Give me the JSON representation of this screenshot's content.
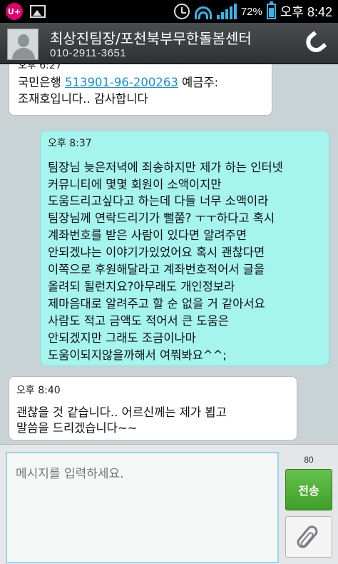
{
  "status_bar": {
    "carrier_logo": "U+",
    "battery_percent": "72%",
    "time": "오후 8:42",
    "icons": [
      "uplus-icon",
      "gallery-icon",
      "alarm-icon",
      "wifi-icon",
      "signal-icon",
      "battery-icon"
    ]
  },
  "header": {
    "contact_name": "최상진팀장/포천북부무한돌봄센터",
    "contact_phone": "010-2911-3651"
  },
  "messages": [
    {
      "direction": "incoming",
      "time": "오후 6:27",
      "text_before": "국민은행 ",
      "account_number": "513901-96-200263",
      "text_after": " 예금주:\n조재호입니다.. 감사합니다"
    },
    {
      "direction": "outgoing",
      "time": "오후 8:37",
      "text": "팀장님 늦은저녁에 죄송하지만 제가 하는 인터넷\n커뮤니티에 몇몇 회원이 소액이지만\n도움드리고싶다고 하는데 다들 너무 소액이라\n팀장님께 연락드리기가 뻘쭘? ㅜㅜ하다고 혹시\n계좌번호를 받은 사람이 있다면 알려주면\n안되겠냐는 이야기가있었어요 혹시 괜찮다면\n이쪽으로 후원해달라고 계좌번호적어서 글을\n올려되 될런지요?아무래도 개인정보라\n제마음대로 알려주고 할 순 없을 거 같아서요\n사람도 적고 금액도 적어서 큰 도움은\n안되겠지만 그래도 조금이나마\n도움이되지않을까해서 여쭤봐요^^;"
    },
    {
      "direction": "incoming",
      "time": "오후 8:40",
      "text": "괜찮을 것 같습니다.. 어르신께는 제가 뵙고\n말씀을 드리겠습니다~~"
    }
  ],
  "composer": {
    "placeholder": "메시지를 입력하세요.",
    "char_count": "80",
    "send_label": "전송"
  },
  "colors": {
    "incoming_bubble": "#ffffff",
    "outgoing_bubble": "#a5f4ee",
    "send_button": "#4cae36",
    "link": "#1e8fd0"
  }
}
